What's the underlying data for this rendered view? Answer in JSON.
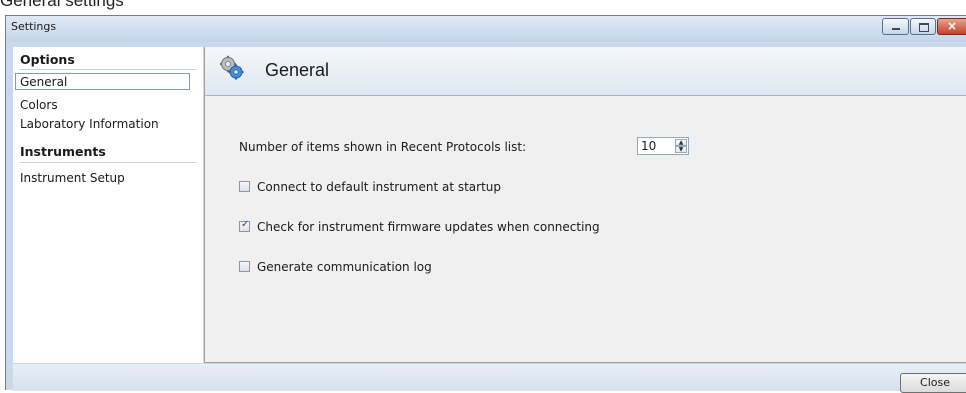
{
  "page": {
    "heading": "General settings"
  },
  "window": {
    "title": "Settings"
  },
  "sidebar": {
    "groups": [
      {
        "header": "Options",
        "items": [
          "General",
          "Colors",
          "Laboratory Information"
        ]
      },
      {
        "header": "Instruments",
        "items": [
          "Instrument Setup"
        ]
      }
    ],
    "selected": "General"
  },
  "panel": {
    "title": "General",
    "recent_label": "Number of items shown in Recent Protocols list:",
    "recent_value": "10",
    "options": [
      {
        "label": "Connect to default instrument at startup",
        "checked": false
      },
      {
        "label": "Check for instrument firmware updates when connecting",
        "checked": true
      },
      {
        "label": "Generate communication log",
        "checked": false
      }
    ]
  },
  "footer": {
    "close_label": "Close"
  },
  "icons": {
    "window_controls": [
      "minimize-icon",
      "maximize-icon",
      "close-icon"
    ],
    "panel": "gears-icon"
  }
}
